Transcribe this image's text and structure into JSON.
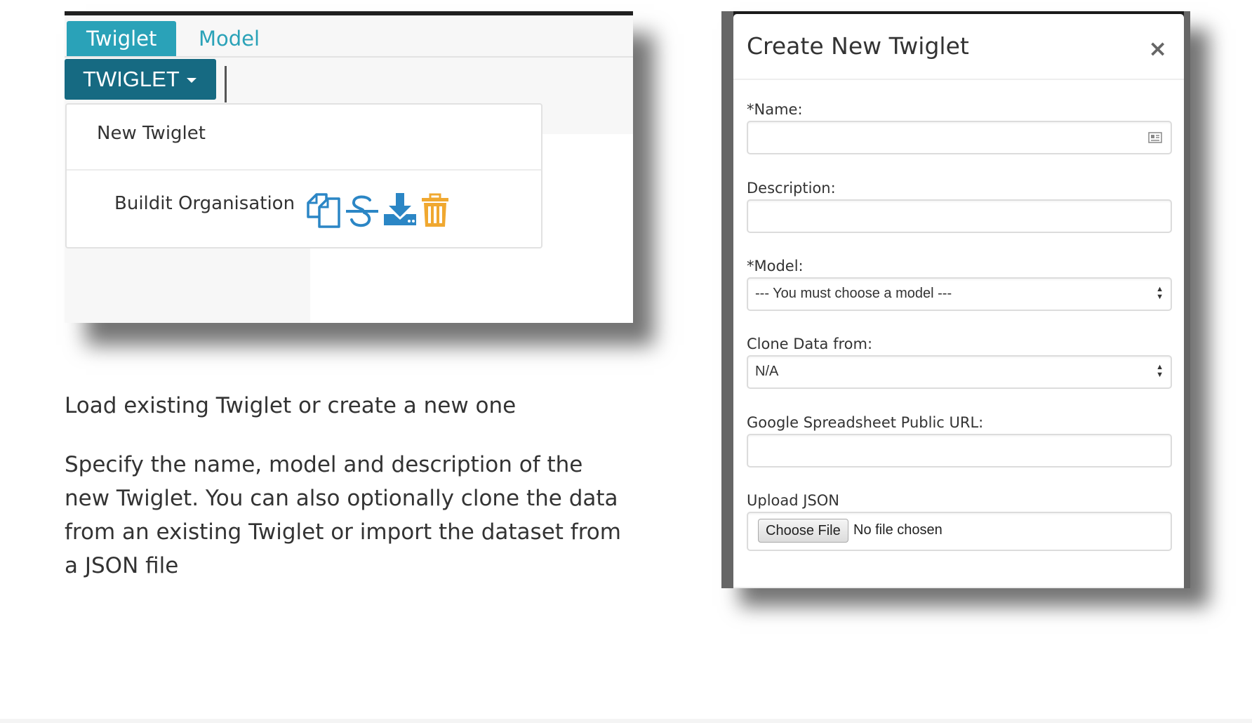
{
  "left_screenshot": {
    "tabs": [
      {
        "label": "Twiglet",
        "active": true
      },
      {
        "label": "Model",
        "active": false
      }
    ],
    "twiglet_button": "TWIGLET",
    "dropdown": {
      "new_item": "New Twiglet",
      "org_item": "Buildit Organisation",
      "org_actions": [
        "clone-icon",
        "rename-icon",
        "download-icon",
        "delete-icon"
      ]
    },
    "colors": {
      "tab_active": "#2aa2b8",
      "button": "#166a82",
      "action_blue": "#2b86c5",
      "delete_orange": "#f0a830"
    }
  },
  "captions": {
    "first": "Load existing Twiglet or create a new one",
    "second": "Specify the name, model and description of the new Twiglet. You can also optionally clone the data from an existing Twiglet or import the dataset from a JSON file"
  },
  "modal": {
    "title": "Create New Twiglet",
    "close": "×",
    "fields": {
      "name_label": "*Name:",
      "name_value": "",
      "description_label": "Description:",
      "description_value": "",
      "model_label": "*Model:",
      "model_selected": "--- You must choose a model ---",
      "clone_label": "Clone Data from:",
      "clone_selected": "N/A",
      "gsheet_label": "Google Spreadsheet Public URL:",
      "gsheet_value": "",
      "upload_label": "Upload JSON",
      "choose_file": "Choose File",
      "no_file": "No file chosen"
    }
  }
}
